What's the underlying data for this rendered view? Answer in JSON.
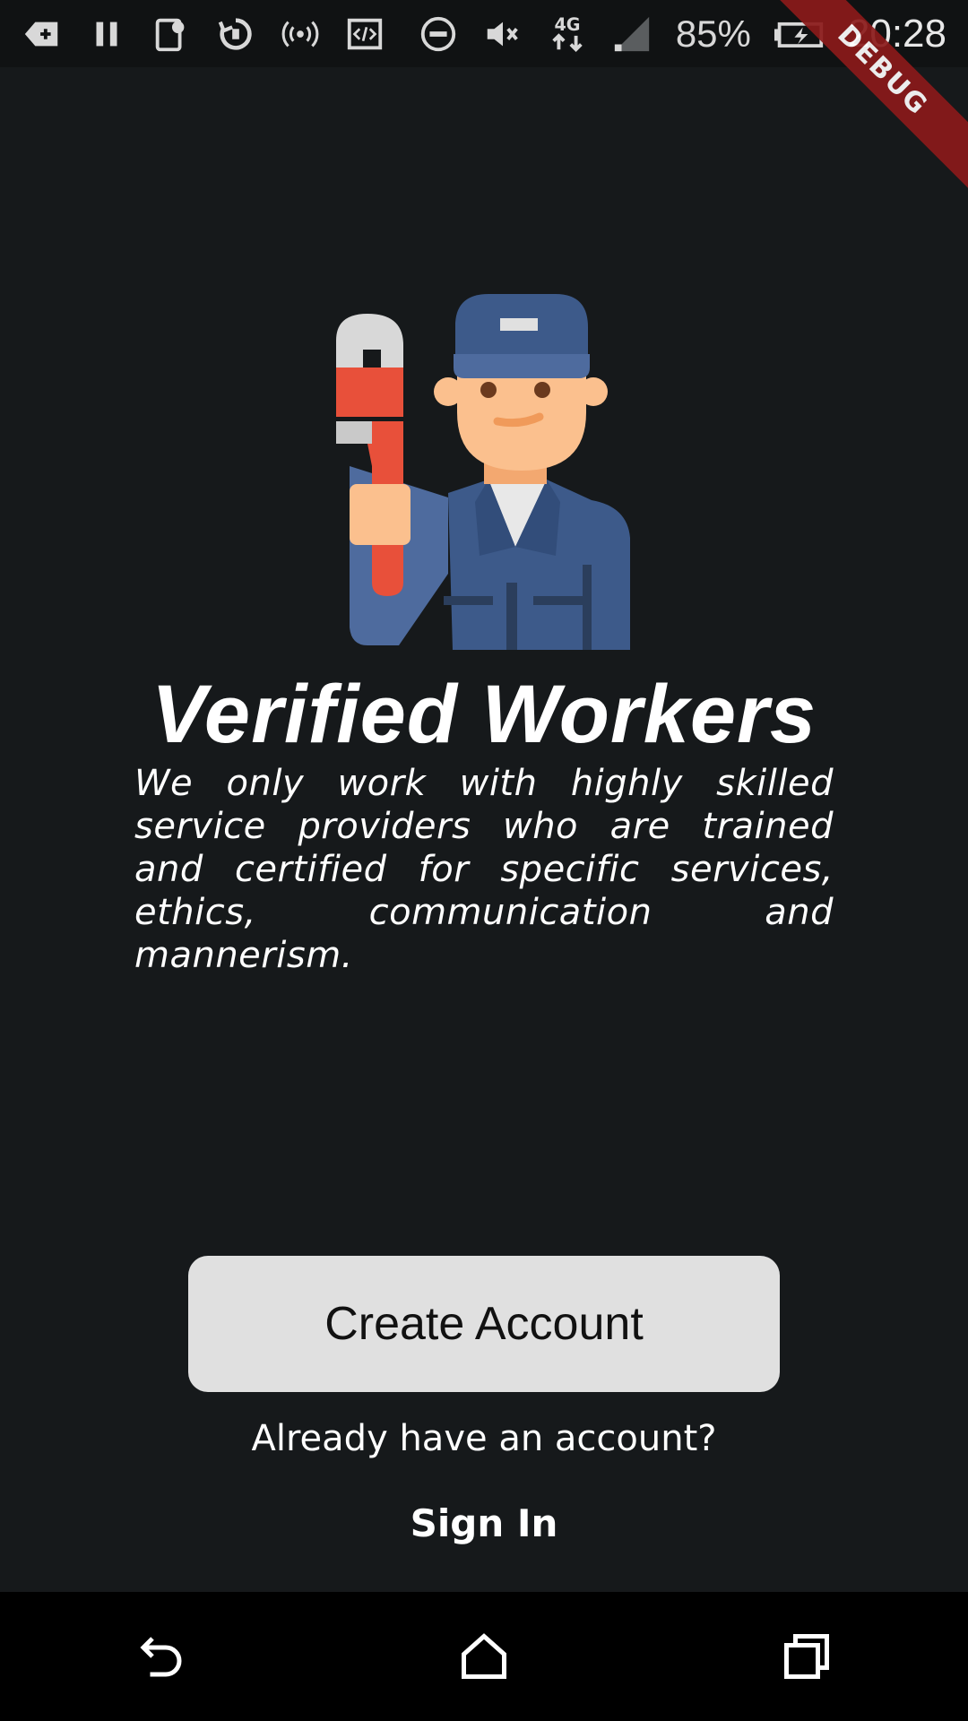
{
  "status_bar": {
    "battery_percent": "85%",
    "network_type": "4G",
    "time": "20:28",
    "icons": [
      "add-notification-icon",
      "pause-icon",
      "screenshot-icon",
      "sync-icon",
      "hotspot-icon",
      "developer-icon",
      "do-not-disturb-icon",
      "mute-icon",
      "network-4g-icon",
      "signal-icon",
      "battery-charging-icon"
    ]
  },
  "debug_banner": "DEBUG",
  "onboarding": {
    "title": "Verified Workers",
    "description": "We only work with highly skilled service providers who are trained and certified for specific services, ethics, communication and mannerism."
  },
  "actions": {
    "create_account_label": "Create Account",
    "already_label": "Already have an account?",
    "sign_in_label": "Sign In"
  },
  "navigation": {
    "buttons": [
      "back-icon",
      "home-icon",
      "recents-icon"
    ]
  },
  "colors": {
    "background": "#16191b",
    "button": "#e0e0e0",
    "debug_banner": "#8b1a1a"
  }
}
